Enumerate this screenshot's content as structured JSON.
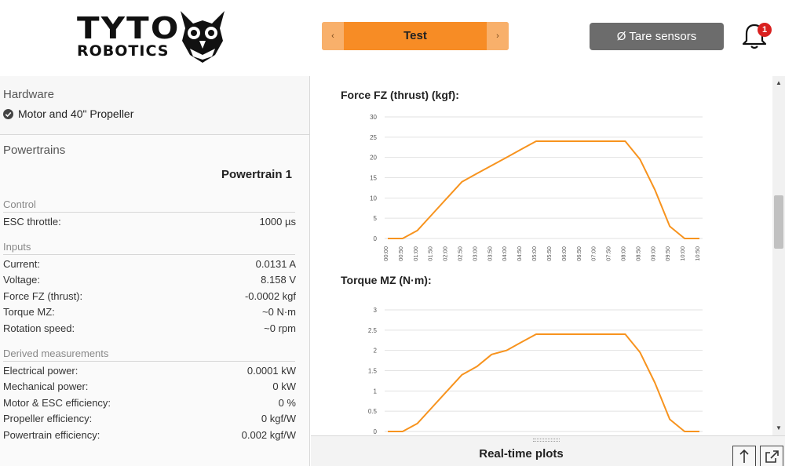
{
  "header": {
    "logo_line1": "TYTO",
    "logo_line2": "ROBOTICS",
    "test_label": "Test",
    "prev_arrow": "‹",
    "next_arrow": "›",
    "tare_label": "Ø Tare sensors",
    "notification_count": "1"
  },
  "sidebar": {
    "hardware_title": "Hardware",
    "hardware_item": "Motor and 40\" Propeller",
    "powertrains_title": "Powertrains",
    "powertrain_name": "Powertrain 1",
    "groups": {
      "control": {
        "title": "Control",
        "rows": [
          {
            "label": "ESC throttle:",
            "value": "1000 µs"
          }
        ]
      },
      "inputs": {
        "title": "Inputs",
        "rows": [
          {
            "label": "Current:",
            "value": "0.0131 A"
          },
          {
            "label": "Voltage:",
            "value": "8.158 V"
          },
          {
            "label": "Force FZ (thrust):",
            "value": "-0.0002 kgf"
          },
          {
            "label": "Torque MZ:",
            "value": "~0 N·m"
          },
          {
            "label": "Rotation speed:",
            "value": "~0 rpm"
          }
        ]
      },
      "derived": {
        "title": "Derived measurements",
        "rows": [
          {
            "label": "Electrical power:",
            "value": "0.0001 kW"
          },
          {
            "label": "Mechanical power:",
            "value": "0 kW"
          },
          {
            "label": "Motor & ESC efficiency:",
            "value": "0 %"
          },
          {
            "label": "Propeller efficiency:",
            "value": "0 kgf/W"
          },
          {
            "label": "Powertrain efficiency:",
            "value": "0.002 kgf/W"
          }
        ]
      }
    }
  },
  "main": {
    "bottom_title": "Real-time plots"
  },
  "colors": {
    "accent": "#f78c25",
    "line": "#f7931e",
    "tare_bg": "#6c6c6c",
    "badge": "#d9201f"
  },
  "chart_data": [
    {
      "type": "line",
      "title": "Force FZ (thrust) (kgf):",
      "categories": [
        "00:00",
        "00:50",
        "01:00",
        "01:50",
        "02:00",
        "02:50",
        "03:00",
        "03:50",
        "04:00",
        "04:50",
        "05:00",
        "05:50",
        "06:00",
        "06:50",
        "07:00",
        "07:50",
        "08:00",
        "08:50",
        "09:00",
        "09:50",
        "10:00",
        "10:50"
      ],
      "values": [
        0,
        0,
        2,
        6,
        10,
        14,
        16,
        18,
        20,
        22,
        24,
        24,
        24,
        24,
        24,
        24,
        24,
        19.5,
        12,
        3,
        0,
        0
      ],
      "yticks": [
        "0",
        "5",
        "10",
        "15",
        "20",
        "25",
        "30"
      ],
      "ylim": [
        0,
        30
      ],
      "grid": true
    },
    {
      "type": "line",
      "title": "Torque MZ (N·m):",
      "values": [
        0,
        0,
        0.2,
        0.6,
        1.0,
        1.4,
        1.6,
        1.9,
        2.0,
        2.2,
        2.4,
        2.4,
        2.4,
        2.4,
        2.4,
        2.4,
        2.4,
        1.95,
        1.2,
        0.3,
        0,
        0
      ],
      "yticks": [
        "0",
        "0.5",
        "1",
        "1.5",
        "2",
        "2.5",
        "3"
      ],
      "ylim": [
        0,
        3
      ],
      "grid": true
    }
  ]
}
